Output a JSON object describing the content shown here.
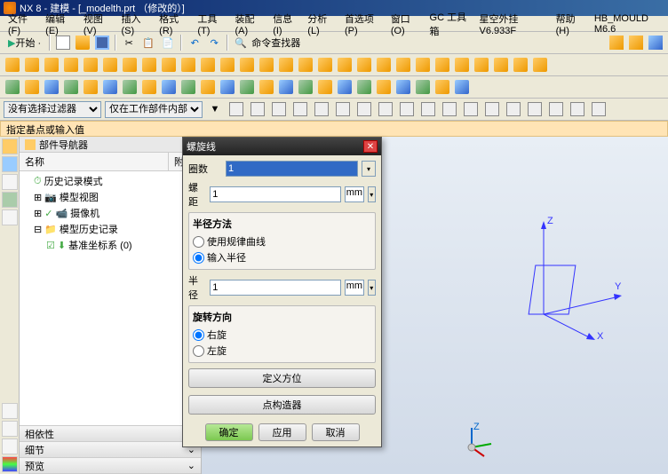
{
  "title": "NX 8 - 建模 - [_modelth.prt （修改的）]",
  "menu": [
    "文件(F)",
    "编辑(E)",
    "视图(V)",
    "插入(S)",
    "格式(R)",
    "工具(T)",
    "装配(A)",
    "信息(I)",
    "分析(L)",
    "首选项(P)",
    "窗口(O)",
    "GC 工具箱",
    "星空外挂 V6.933F",
    "帮助(H)",
    "HB_MOULD M6.6"
  ],
  "start_label": "开始 · ",
  "cmd_finder": "命令查找器",
  "filter1": "没有选择过滤器",
  "filter2": "仅在工作部件内部",
  "msgbar": "指定基点或输入值",
  "nav": {
    "title": "部件导航器",
    "col1": "名称",
    "col2": "附注",
    "items": [
      "历史记录模式",
      "模型视图",
      "摄像机",
      "模型历史记录",
      "基准坐标系 (0)"
    ]
  },
  "accordion": [
    "相依性",
    "细节",
    "预览"
  ],
  "dialog": {
    "title": "螺旋线",
    "turns_label": "圈数",
    "turns_val": "1",
    "pitch_label": "螺距",
    "pitch_val": "1",
    "pitch_unit": "mm",
    "radius_group": "半径方法",
    "radius_opt1": "使用规律曲线",
    "radius_opt2": "输入半径",
    "radius_label": "半径",
    "radius_val": "1",
    "radius_unit": "mm",
    "dir_group": "旋转方向",
    "dir_opt1": "右旋",
    "dir_opt2": "左旋",
    "define_btn": "定义方位",
    "point_btn": "点构造器",
    "ok": "确定",
    "apply": "应用",
    "cancel": "取消"
  }
}
